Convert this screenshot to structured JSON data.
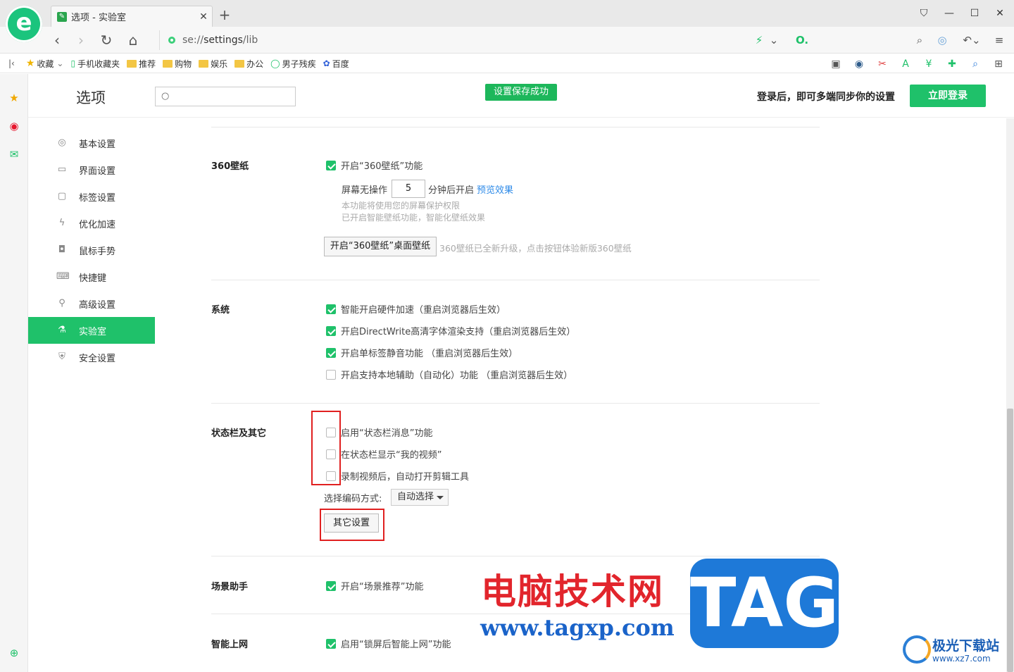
{
  "browser": {
    "logo_letter": "e",
    "tab": {
      "title": "选项 - 实验室"
    },
    "address": {
      "scheme": "se://",
      "path": "settings",
      "suffix": "/lib"
    },
    "bookmarks": [
      {
        "label": "收藏",
        "icon": "star-icon"
      },
      {
        "label": "手机收藏夹",
        "icon": "phone-icon"
      },
      {
        "label": "推荐",
        "icon": "folder-icon"
      },
      {
        "label": "购物",
        "icon": "folder-icon"
      },
      {
        "label": "娱乐",
        "icon": "folder-icon"
      },
      {
        "label": "办公",
        "icon": "folder-icon"
      },
      {
        "label": "男子残疾",
        "icon": "site-icon"
      },
      {
        "label": "百度",
        "icon": "baidu-icon"
      }
    ]
  },
  "header": {
    "title": "选项",
    "search_placeholder": "",
    "toast": "设置保存成功",
    "login_tip": "登录后，即可多端同步你的设置",
    "login_button": "立即登录"
  },
  "menu": [
    {
      "label": "基本设置",
      "icon": "gear-icon",
      "active": false
    },
    {
      "label": "界面设置",
      "icon": "window-icon",
      "active": false
    },
    {
      "label": "标签设置",
      "icon": "tab-icon",
      "active": false
    },
    {
      "label": "优化加速",
      "icon": "lightning-icon",
      "active": false
    },
    {
      "label": "鼠标手势",
      "icon": "mouse-icon",
      "active": false
    },
    {
      "label": "快捷键",
      "icon": "keyboard-icon",
      "active": false
    },
    {
      "label": "高级设置",
      "icon": "wrench-icon",
      "active": false
    },
    {
      "label": "实验室",
      "icon": "flask-icon",
      "active": true
    },
    {
      "label": "安全设置",
      "icon": "shield-icon",
      "active": false
    }
  ],
  "sections": {
    "wallpaper": {
      "title": "360壁纸",
      "enable": {
        "label": "开启“360壁纸”功能",
        "checked": true
      },
      "idle_prefix": "屏幕无操作",
      "idle_minutes": "5",
      "idle_suffix": "分钟后开启",
      "preview_link": "预览效果",
      "note1": "本功能将使用您的屏幕保护权限",
      "note2": "已开启智能壁纸功能，智能化壁纸效果",
      "desktop_button": "开启“360壁纸”桌面壁纸",
      "desktop_note": "360壁纸已全新升级，点击按钮体验新版360壁纸"
    },
    "system": {
      "title": "系统",
      "options": [
        {
          "label": "智能开启硬件加速（重启浏览器后生效）",
          "checked": true
        },
        {
          "label": "开启DirectWrite高清字体渲染支持（重启浏览器后生效）",
          "checked": true
        },
        {
          "label": "开启单标签静音功能 （重启浏览器后生效）",
          "checked": true
        },
        {
          "label": "开启支持本地辅助（自动化）功能 （重启浏览器后生效）",
          "checked": false
        }
      ]
    },
    "statusbar": {
      "title": "状态栏及其它",
      "options": [
        {
          "label": "启用“状态栏消息”功能",
          "checked": false
        },
        {
          "label": "在状态栏显示“我的视频”",
          "checked": false
        },
        {
          "label": "录制视频后，自动打开剪辑工具",
          "checked": false
        }
      ],
      "encoding_label": "选择编码方式:",
      "encoding_value": "自动选择",
      "other_button": "其它设置"
    },
    "scene": {
      "title": "场景助手",
      "option": {
        "label": "开启“场景推荐”功能",
        "checked": true
      }
    },
    "smart": {
      "title": "智能上网",
      "option": {
        "label": "启用“锁屏后智能上网”功能",
        "checked": true
      }
    }
  },
  "watermark": {
    "cn": "电脑技术网",
    "url": "www.tagxp.com",
    "tag": "TAG",
    "brand": "极光下载站",
    "brand_url": "www.xz7.com"
  }
}
